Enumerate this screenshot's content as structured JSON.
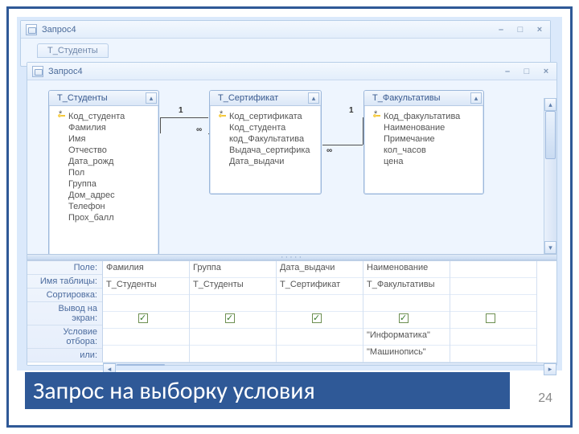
{
  "window": {
    "back_title": "Запрос4",
    "front_title": "Запрос4",
    "ghost_tab": "Т_Студенты"
  },
  "tables": {
    "students": {
      "title": "Т_Студенты",
      "fields": [
        "Код_студента",
        "Фамилия",
        "Имя",
        "Отчество",
        "Дата_рожд",
        "Пол",
        "Группа",
        "Дом_адрес",
        "Телефон",
        "Прох_балл"
      ]
    },
    "cert": {
      "title": "Т_Сертификат",
      "fields": [
        "Код_сертификата",
        "Код_студента",
        "код_Факультатива",
        "Выдача_сертифика",
        "Дата_выдачи"
      ]
    },
    "fac": {
      "title": "Т_Факультативы",
      "fields": [
        "Код_факультатива",
        "Наименование",
        "Примечание",
        "кол_часов",
        "цена"
      ]
    }
  },
  "relations": {
    "one": "1",
    "many": "∞"
  },
  "grid": {
    "row_labels": [
      "Поле:",
      "Имя таблицы:",
      "Сортировка:",
      "Вывод на экран:",
      "Условие отбора:",
      "или:"
    ],
    "columns": [
      {
        "field": "Фамилия",
        "table": "Т_Студенты",
        "sort": "",
        "show": true,
        "crit": "",
        "or": ""
      },
      {
        "field": "Группа",
        "table": "Т_Студенты",
        "sort": "",
        "show": true,
        "crit": "",
        "or": ""
      },
      {
        "field": "Дата_выдачи",
        "table": "Т_Сертификат",
        "sort": "",
        "show": true,
        "crit": "",
        "or": ""
      },
      {
        "field": "Наименование",
        "table": "Т_Факультативы",
        "sort": "",
        "show": true,
        "crit": "\"Информатика\"",
        "or": "\"Машинопись\""
      },
      {
        "field": "",
        "table": "",
        "sort": "",
        "show": false,
        "crit": "",
        "or": ""
      }
    ]
  },
  "banner": "Запрос на выборку условия",
  "page": "24"
}
